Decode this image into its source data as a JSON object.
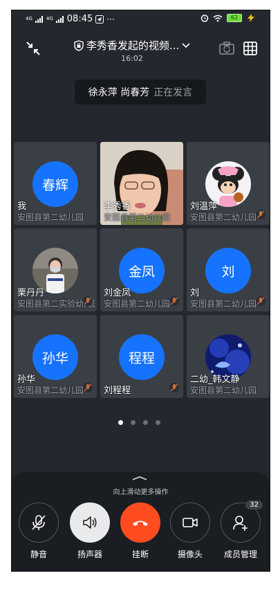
{
  "status": {
    "time": "08:45",
    "signal1": "4G",
    "signal2": "4G",
    "battery": "62",
    "accent": "#6ddc3a"
  },
  "header": {
    "title": "李秀香发起的视频...",
    "time": "16:02"
  },
  "speaking": {
    "names": "徐永萍 尚春芳",
    "status": "正在发言"
  },
  "participants": [
    {
      "avatar_text": "春辉",
      "name": "我",
      "org": "安图县第二幼儿园",
      "muted": false,
      "type": "text"
    },
    {
      "avatar_text": "",
      "name": "李秀香",
      "org": "安图县第二幼儿园",
      "muted": false,
      "type": "video"
    },
    {
      "avatar_text": "",
      "name": "刘温萍",
      "org": "安图县第二幼儿园",
      "muted": true,
      "type": "photo-mouse"
    },
    {
      "avatar_text": "",
      "name": "栗丹丹",
      "org": "安图县第二实验幼儿园",
      "muted": true,
      "type": "photo-person"
    },
    {
      "avatar_text": "金凤",
      "name": "刘金凤",
      "org": "安图县第二幼儿园",
      "muted": true,
      "type": "text"
    },
    {
      "avatar_text": "刘",
      "name": "刘",
      "org": "安图县第二幼儿园",
      "muted": true,
      "type": "text"
    },
    {
      "avatar_text": "孙华",
      "name": "孙华",
      "org": "安图县第二幼儿园",
      "muted": true,
      "type": "text"
    },
    {
      "avatar_text": "程程",
      "name": "刘程程",
      "org": "",
      "muted": true,
      "type": "text"
    },
    {
      "avatar_text": "",
      "name": "二幼_韩文静",
      "org": "安图县第二幼儿园",
      "muted": false,
      "type": "photo-aquarium"
    }
  ],
  "pager": {
    "total": 4,
    "active": 1
  },
  "controls": {
    "hint": "向上滑动更多操作",
    "mute": "静音",
    "speaker": "扬声器",
    "hangup": "挂断",
    "camera": "摄像头",
    "members": "成员管理",
    "member_count": "32"
  },
  "colors": {
    "avatar_blue": "#1673ff",
    "hangup_red": "#ff4d20",
    "tile_bg": "#3a3f46"
  }
}
